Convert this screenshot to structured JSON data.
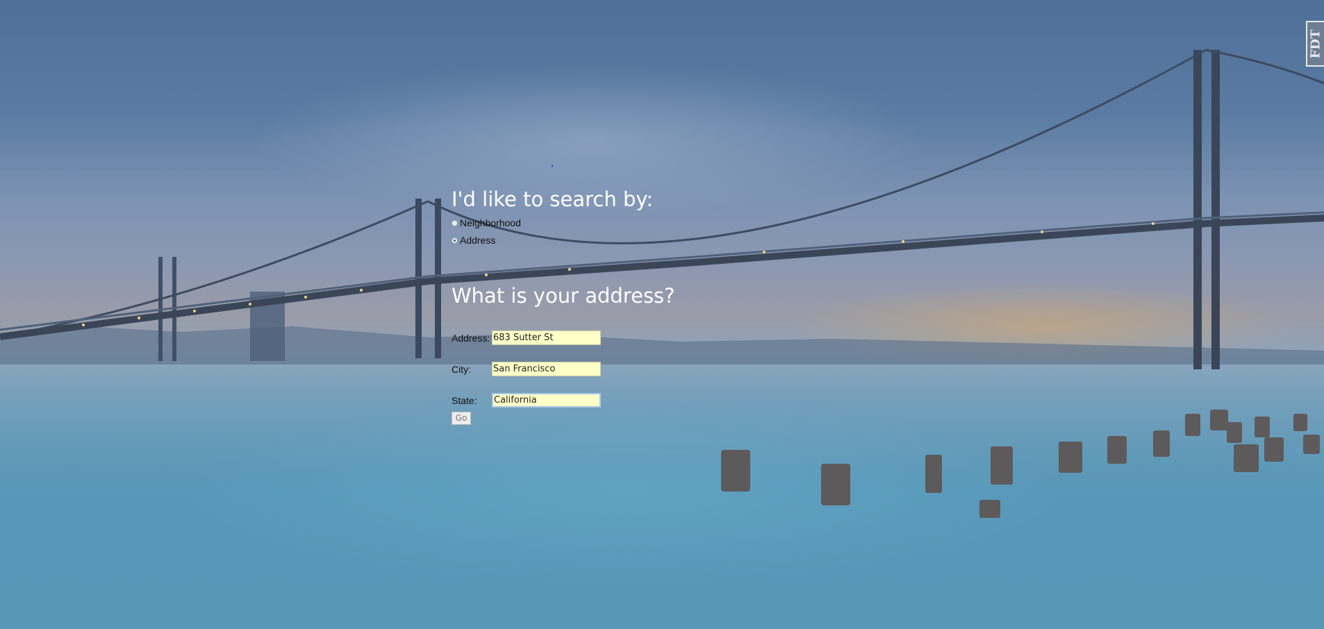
{
  "search_by": {
    "heading": "I'd like to search by:",
    "options": [
      {
        "label": "Neighborhood",
        "selected": false
      },
      {
        "label": "Address",
        "selected": true
      }
    ]
  },
  "address_form": {
    "heading": "What is your address?",
    "fields": {
      "address": {
        "label": "Address:",
        "value": "683 Sutter St"
      },
      "city": {
        "label": "City:",
        "value": "San Francisco"
      },
      "state": {
        "label": "State:",
        "value": "California"
      }
    },
    "submit_label": "Go"
  },
  "badge": {
    "text": "FDT"
  },
  "colors": {
    "input_background": "#ffffc8",
    "heading_text": "#ffffff"
  }
}
